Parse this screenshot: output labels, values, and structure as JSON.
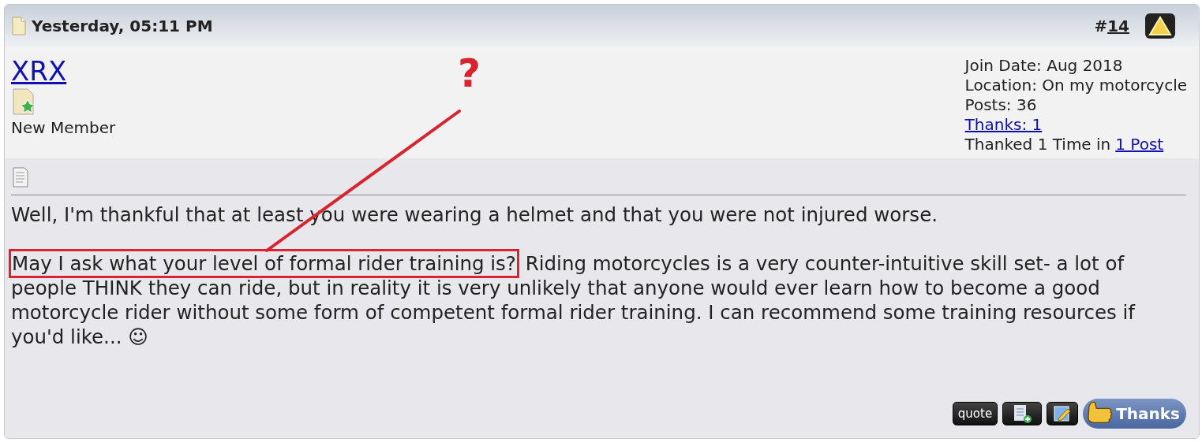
{
  "post": {
    "date": "Yesterday, 05:11 PM",
    "number_prefix": "#",
    "number": "14"
  },
  "user": {
    "name": "XRX",
    "title": "New Member"
  },
  "user_info": [
    {
      "kind": "text",
      "text": "Join Date: Aug 2018"
    },
    {
      "kind": "text",
      "text": "Location: On my motorcycle"
    },
    {
      "kind": "text",
      "text": "Posts: 36"
    },
    {
      "kind": "link",
      "text": "Thanks: 1"
    },
    {
      "kind": "mixed",
      "text": "Thanked 1 Time in",
      "link": "1 Post"
    }
  ],
  "message": [
    {
      "text": "Well, I'm thankful that at least you were wearing a helmet and that you were not injured worse."
    },
    {
      "highlight": "May I ask what your level of formal rider training is?",
      "text": "Riding motorcycles is a very counter-intuitive skill set- a lot of people THINK they can ride, but in reality it is very unlikely that anyone would ever learn how to become a good motorcycle rider without some form of competent formal rider training. I can recommend some training resources if you'd like... ☺"
    }
  ],
  "annotation": {
    "mark": "?"
  },
  "buttons": [
    {
      "kind": "quote",
      "label": "quote"
    },
    {
      "kind": "multiquote"
    },
    {
      "kind": "edit"
    },
    {
      "kind": "thanks",
      "label": "Thanks"
    }
  ]
}
